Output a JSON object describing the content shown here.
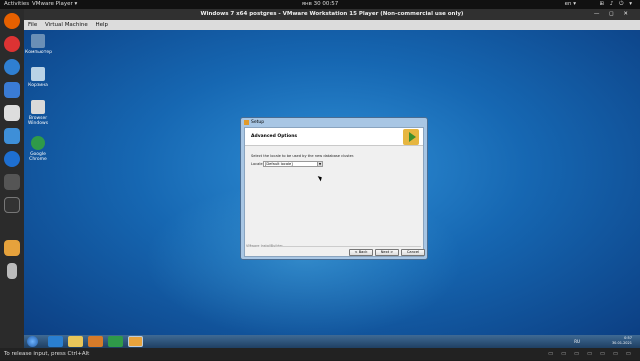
{
  "topbar": {
    "activities": "Activities",
    "app": "VMware Player ▾",
    "clock": "янв 30  00:57",
    "lang": "en ▾",
    "system_icons": "⊞ ♪ ⏻ ▾"
  },
  "window": {
    "title": "Windows 7 x64 postgres - VMware Workstation 15 Player (Non-commercial use only)",
    "controls": "— ◻ ✕"
  },
  "vm_menu": {
    "items": [
      "File",
      "Virtual Machine",
      "Help"
    ]
  },
  "desktop": {
    "icons": [
      {
        "label": "Компьютер",
        "icon": "computer-icon",
        "color": "#6a8fb6"
      },
      {
        "label": "Корзина",
        "icon": "recycle-bin-icon",
        "color": "#b9d2e6"
      },
      {
        "label": "Browser Windows",
        "icon": "browser-icon",
        "color": "#d9d9d9"
      },
      {
        "label": "Google Chrome",
        "icon": "chrome-icon",
        "color": "#2f9a49"
      }
    ]
  },
  "dialog": {
    "title": "Setup",
    "header": "Advanced Options",
    "description": "Select the locale to be used by the new database cluster.",
    "locale_label": "Locale",
    "locale_value": "[Default locale]",
    "brand": "VMware InstallBuilder",
    "back": "< Back",
    "next": "Next >",
    "cancel": "Cancel"
  },
  "taskbar": {
    "lang": "RU",
    "time": "0:57",
    "date": "30.01.2021"
  },
  "status": {
    "text": "To release input, press Ctrl+Alt",
    "devices": "▭ ▭ ▭ ▭ ▭ ▭ ▭"
  },
  "colors": {
    "accent": "#1667b2",
    "dock_bg": "#2b2b2b"
  }
}
